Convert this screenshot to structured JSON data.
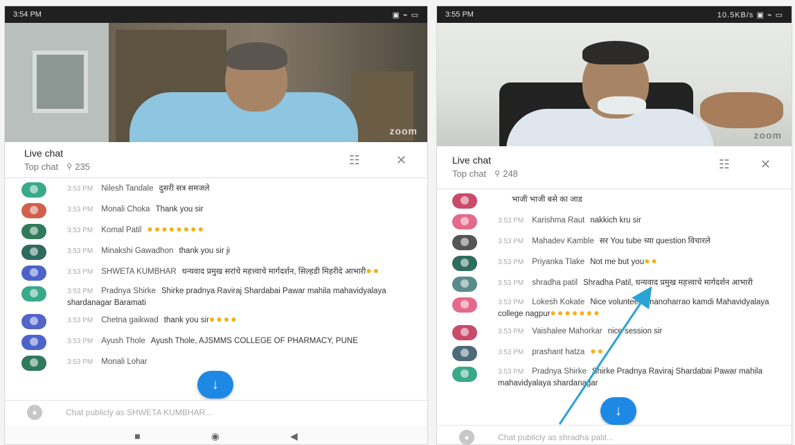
{
  "left_phone": {
    "status": {
      "time": "3:54 PM",
      "icons": "▣ ⌁ ▭"
    },
    "zoom_label": "zoom",
    "chat": {
      "title": "Live chat",
      "mode": "Top chat",
      "viewers": "235",
      "messages": [
        {
          "time": "3:53 PM",
          "author": "Nilesh Tandale",
          "text": "दुसरी सत्र समजले",
          "emojis": "",
          "color": "#3aa88a"
        },
        {
          "time": "3:53 PM",
          "author": "Monali Choka",
          "text": "Thank you sir",
          "emojis": "",
          "color": "#d0604b"
        },
        {
          "time": "3:53 PM",
          "author": "Komal Patil",
          "text": "",
          "emojis": "●●●●●●●●",
          "color": "#2f7a5a"
        },
        {
          "time": "3:53 PM",
          "author": "Minakshi Gawadhon",
          "text": "thank you sir ji",
          "emojis": "",
          "color": "#2f6b5e"
        },
        {
          "time": "3:53 PM",
          "author": "SHWETA KUMBHAR",
          "text": "धन्यवाद प्रमुख सरांचे महत्त्वाचे मार्गदर्शन, सिल्हडी मिहरीदे आभारी",
          "emojis": "●●",
          "color": "#4d63c9"
        },
        {
          "time": "3:53 PM",
          "author": "Pradnya Shirke",
          "text": "Shirke pradnya Raviraj Shardabai Pawar mahila mahavidyalaya shardanagar Baramati",
          "emojis": "",
          "color": "#3aa88a"
        },
        {
          "time": "3:53 PM",
          "author": "Chetna gaikwad",
          "text": "thank you sir",
          "emojis": "●●●●",
          "color": "#5264c8"
        },
        {
          "time": "3:53 PM",
          "author": "Ayush Thole",
          "text": "Ayush Thole, AJSMMS COLLEGE OF PHARMACY, PUNE",
          "emojis": "",
          "color": "#4d63c9"
        },
        {
          "time": "3:53 PM",
          "author": "Monali Lohar",
          "text": "",
          "emojis": "",
          "color": "#2f7a5a"
        }
      ]
    },
    "input_placeholder": "Chat publicly as SHWETA KUMBHAR..."
  },
  "right_phone": {
    "status": {
      "time": "3:55 PM",
      "icons": "10.5KB/s ▣ ⌁ ▭"
    },
    "zoom_label": "zoom",
    "chat": {
      "title": "Live chat",
      "mode": "Top chat",
      "viewers": "248",
      "messages": [
        {
          "time": "",
          "author": "",
          "text": "भाजी भाजी बसे का जाड",
          "emojis": "",
          "color": "#c94a6a"
        },
        {
          "time": "3:53 PM",
          "author": "Karishma Raut",
          "text": "nakkich kru sir",
          "emojis": "",
          "color": "#e46a8c"
        },
        {
          "time": "3:53 PM",
          "author": "Mahadev Kamble",
          "text": "सर You tube च्या question विचारले",
          "emojis": "",
          "color": "#555555"
        },
        {
          "time": "3:53 PM",
          "author": "Priyanka Tlake",
          "text": "Not me but you",
          "emojis": "●●",
          "color": "#2f6b5e"
        },
        {
          "time": "3:53 PM",
          "author": "shradha patil",
          "text": "Shradha Patil, धन्यवाद प्रमुख महत्त्वाचे मार्गदर्शन आभारी",
          "emojis": "",
          "color": "#5a8d8a"
        },
        {
          "time": "3:53 PM",
          "author": "Lokesh Kokate",
          "text": "Nice volunteers manoharrao kamdi Mahavidyalaya college nagpur",
          "emojis": "●●●●●●●",
          "color": "#e46a8c"
        },
        {
          "time": "3:53 PM",
          "author": "Vaishalee Mahorkar",
          "text": "nice session sir",
          "emojis": "",
          "color": "#c94a6a"
        },
        {
          "time": "3:53 PM",
          "author": "prashant hatza",
          "text": "",
          "emojis": "●●",
          "color": "#4e6a7a"
        },
        {
          "time": "3:53 PM",
          "author": "Pradnya Shirke",
          "text": "Shirke Pradnya Raviraj Shardabai Pawar mahila mahavidyalaya shardanagar",
          "emojis": "",
          "color": "#3aa88a"
        }
      ]
    },
    "input_placeholder": "Chat publicly as shradha patil..."
  },
  "colors": {
    "accent_blue": "#1e88e5",
    "arrow": "#2ba3d6",
    "emoji_gold": "#f1b21c"
  }
}
